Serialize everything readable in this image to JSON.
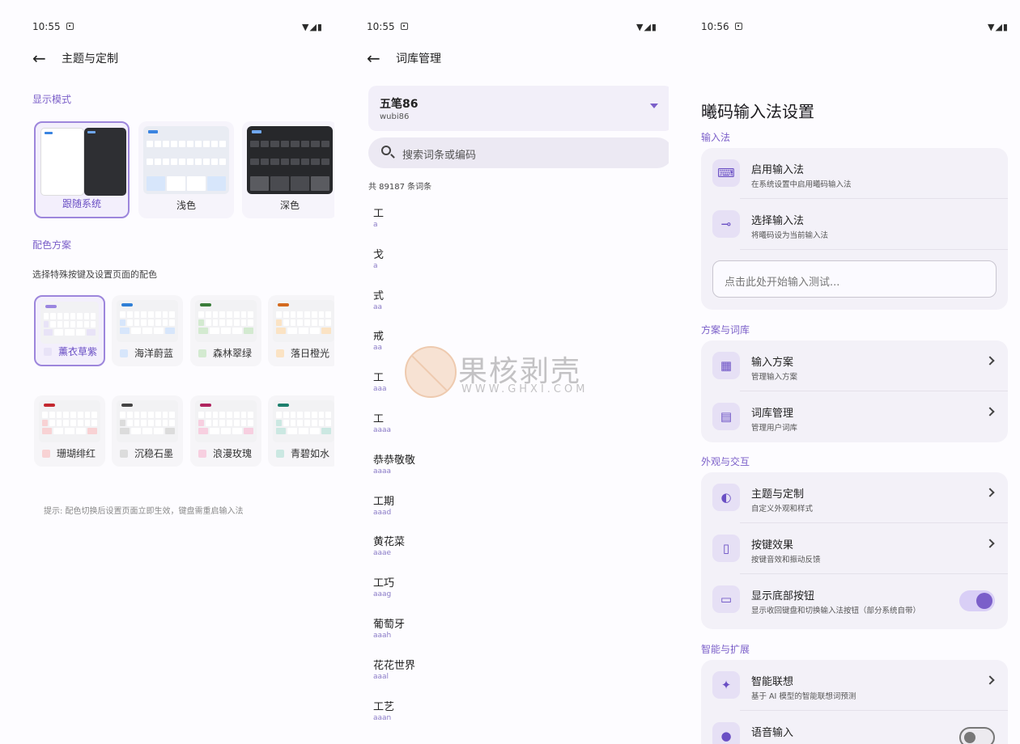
{
  "panel1": {
    "status": {
      "time": "10:55",
      "icons": "▼◢▮"
    },
    "title": "主题与定制",
    "display_mode_label": "显示模式",
    "modes": [
      {
        "label": "跟随系统",
        "selected": true
      },
      {
        "label": "浅色",
        "selected": false
      },
      {
        "label": "深色",
        "selected": false
      }
    ],
    "color_scheme_label": "配色方案",
    "color_scheme_hint": "选择特殊按键及设置页面的配色",
    "schemes": [
      {
        "label": "薰衣草紫",
        "color": "#9b86e0",
        "light": "#e8e3f7",
        "selected": true
      },
      {
        "label": "海洋蔚蓝",
        "color": "#2f7fd6",
        "light": "#d7e6fb",
        "selected": false
      },
      {
        "label": "森林翠绿",
        "color": "#3a7d3a",
        "light": "#d3ead0",
        "selected": false
      },
      {
        "label": "落日橙光",
        "color": "#d46a1e",
        "light": "#fbe3c4",
        "selected": false
      },
      {
        "label": "珊瑚绯红",
        "color": "#c3282f",
        "light": "#f8d2d4",
        "selected": false
      },
      {
        "label": "沉稳石墨",
        "color": "#444444",
        "light": "#dcdcdc",
        "selected": false
      },
      {
        "label": "浪漫玫瑰",
        "color": "#b0245f",
        "light": "#f7cfe0",
        "selected": false
      },
      {
        "label": "青碧如水",
        "color": "#1d7f6d",
        "light": "#cbe8e2",
        "selected": false
      }
    ],
    "tip": "提示: 配色切换后设置页面立即生效，键盘需重启输入法"
  },
  "panel2": {
    "status": {
      "time": "10:55",
      "icons": "▼◢▮"
    },
    "title": "词库管理",
    "dropdown": {
      "title": "五笔86",
      "sub": "wubi86"
    },
    "search_placeholder": "搜索词条或编码",
    "count": "共 89187 条词条",
    "entries": [
      {
        "word": "工",
        "code": "a"
      },
      {
        "word": "戈",
        "code": "a"
      },
      {
        "word": "式",
        "code": "aa"
      },
      {
        "word": "戒",
        "code": "aa"
      },
      {
        "word": "工",
        "code": "aaa"
      },
      {
        "word": "工",
        "code": "aaaa"
      },
      {
        "word": "恭恭敬敬",
        "code": "aaaa"
      },
      {
        "word": "工期",
        "code": "aaad"
      },
      {
        "word": "黄花菜",
        "code": "aaae"
      },
      {
        "word": "工巧",
        "code": "aaag"
      },
      {
        "word": "葡萄牙",
        "code": "aaah"
      },
      {
        "word": "花花世界",
        "code": "aaal"
      },
      {
        "word": "工艺",
        "code": "aaan"
      }
    ]
  },
  "panel3": {
    "status": {
      "time": "10:56",
      "icons": "▼◢▮"
    },
    "title": "曦码输入法设置",
    "sections": {
      "input": "输入法",
      "scheme": "方案与词库",
      "appearance": "外观与交互",
      "smart": "智能与扩展"
    },
    "rows": {
      "enable": {
        "title": "启用输入法",
        "sub": "在系统设置中启用曦码输入法"
      },
      "select": {
        "title": "选择输入法",
        "sub": "将曦码设为当前输入法"
      },
      "test_placeholder": "点击此处开始输入测试...",
      "scheme": {
        "title": "输入方案",
        "sub": "管理输入方案"
      },
      "dict": {
        "title": "词库管理",
        "sub": "管理用户词库"
      },
      "theme": {
        "title": "主题与定制",
        "sub": "自定义外观和样式"
      },
      "keyfx": {
        "title": "按键效果",
        "sub": "按键音效和振动反馈"
      },
      "bottombtn": {
        "title": "显示底部按钮",
        "sub": "显示收回键盘和切换输入法按钮（部分系统自带）",
        "on": true
      },
      "smartassoc": {
        "title": "智能联想",
        "sub": "基于 AI 模型的智能联想词预测"
      },
      "partial": {
        "title": "语音输入"
      }
    }
  },
  "watermark": {
    "cn": "果核剥壳",
    "en": "WWW.GHXI.COM"
  }
}
